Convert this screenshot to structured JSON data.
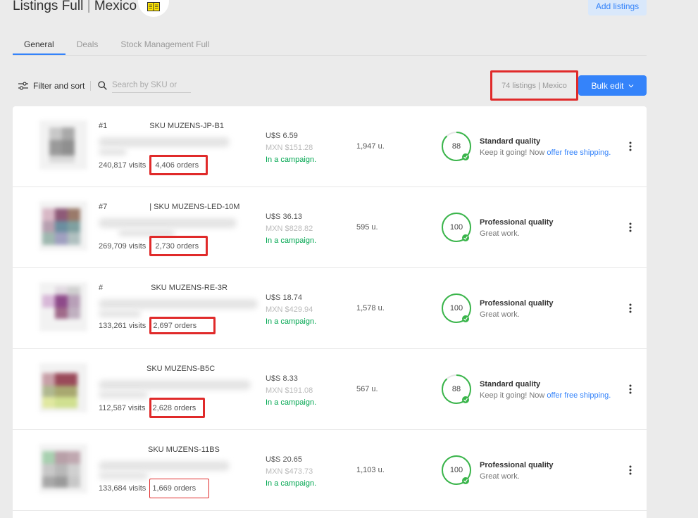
{
  "header": {
    "title_main": "Listings Full",
    "title_sep": " | ",
    "title_country": "Mexico",
    "add_listings_label": "Add listings"
  },
  "tabs": [
    {
      "label": "General",
      "active": true
    },
    {
      "label": "Deals",
      "active": false
    },
    {
      "label": "Stock Management Full",
      "active": false
    }
  ],
  "toolbar": {
    "filter_label": "Filter and sort",
    "search_placeholder": "Search by SKU or",
    "listings_count": "74 listings | Mexico",
    "bulk_edit_label": "Bulk edit"
  },
  "colors": {
    "accent": "#3483fa",
    "success": "#00a650",
    "highlight": "#e02a2a",
    "ring": "#39b54a"
  },
  "listings": [
    {
      "id_prefix": "#1",
      "sku": "SKU MUZENS-JP-B1",
      "visits": "240,817 visits",
      "orders": "4,406 orders",
      "price_usd": "U$S 6.59",
      "price_mxn": "MXN $151.28",
      "campaign": "In a campaign.",
      "units": "1,947 u.",
      "score": "88",
      "score_fraction": 0.88,
      "quality_title": "Standard quality",
      "quality_desc": "Keep it going! Now ",
      "quality_link": "offer free shipping."
    },
    {
      "id_prefix": "#7",
      "sku": "| SKU MUZENS-LED-10M",
      "visits": "269,709 visits",
      "orders": "2,730 orders",
      "price_usd": "U$S 36.13",
      "price_mxn": "MXN $828.82",
      "campaign": "In a campaign.",
      "units": "595 u.",
      "score": "100",
      "score_fraction": 1.0,
      "quality_title": "Professional quality",
      "quality_desc": "Great work.",
      "quality_link": ""
    },
    {
      "id_prefix": "#",
      "sku": "SKU MUZENS-RE-3R",
      "visits": "133,261 visits",
      "orders": "2,697 orders",
      "price_usd": "U$S 18.74",
      "price_mxn": "MXN $429.94",
      "campaign": "In a campaign.",
      "units": "1,578 u.",
      "score": "100",
      "score_fraction": 1.0,
      "quality_title": "Professional quality",
      "quality_desc": "Great work.",
      "quality_link": ""
    },
    {
      "id_prefix": "",
      "sku": "SKU MUZENS-B5C",
      "visits": "112,587 visits",
      "orders": "2,628 orders",
      "price_usd": "U$S 8.33",
      "price_mxn": "MXN $191.08",
      "campaign": "In a campaign.",
      "units": "567 u.",
      "score": "88",
      "score_fraction": 0.88,
      "quality_title": "Standard quality",
      "quality_desc": "Keep it going! Now ",
      "quality_link": "offer free shipping."
    },
    {
      "id_prefix": "",
      "sku": "SKU MUZENS-11BS",
      "visits": "133,684 visits",
      "orders": "1,669 orders",
      "price_usd": "U$S 20.65",
      "price_mxn": "MXN $473.73",
      "campaign": "In a campaign.",
      "units": "1,103 u.",
      "score": "100",
      "score_fraction": 1.0,
      "quality_title": "Professional quality",
      "quality_desc": "Great work.",
      "quality_link": ""
    }
  ]
}
